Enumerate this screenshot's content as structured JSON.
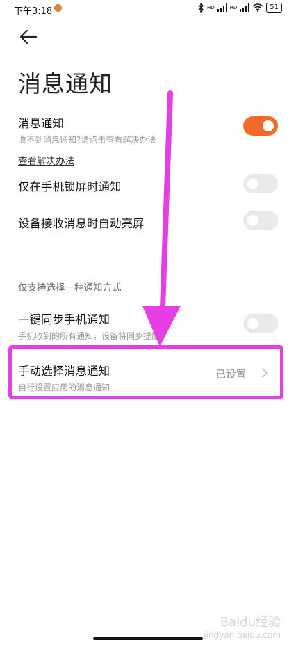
{
  "status_bar": {
    "time": "下午3:18",
    "signal_1": "HD",
    "signal_2": "HD",
    "battery": "51"
  },
  "header": {
    "back_icon": "arrow-left-icon",
    "title": "消息通知"
  },
  "settings": {
    "message_notification": {
      "title": "消息通知",
      "subtitle": "收不到消息通知?请点击查看解决办法",
      "enabled": true
    },
    "solution_link": "查看解决办法",
    "lockscreen_only": {
      "title": "仅在手机锁屏时通知",
      "enabled": false
    },
    "auto_wake": {
      "title": "设备接收消息时自动亮屏",
      "enabled": false
    },
    "section_label": "仅支持选择一种通知方式",
    "one_key_sync": {
      "title": "一键同步手机通知",
      "subtitle": "手机收到的所有通知，设备将同步提醒",
      "enabled": false
    },
    "manual_select": {
      "title": "手动选择消息通知",
      "subtitle": "自行设置应用的消息通知",
      "value": "已设置",
      "chevron_icon": "chevron-right-icon"
    }
  },
  "colors": {
    "toggle_on": "#f26a2a",
    "toggle_off": "#eaeaea",
    "annotation": "#e53ee5"
  },
  "watermark": {
    "line1": "Baidu经验",
    "line2": "jingyan.baidu.com"
  }
}
